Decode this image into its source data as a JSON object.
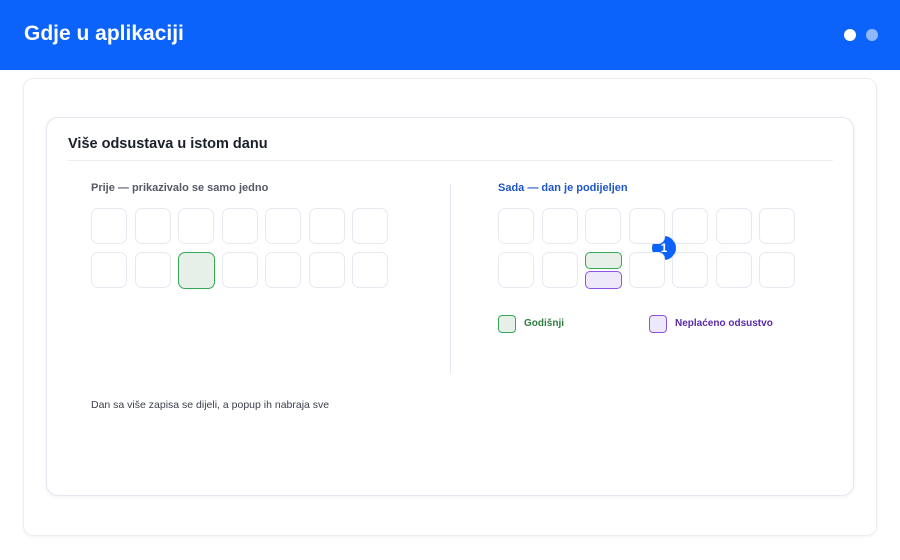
{
  "header": {
    "title": "Gdje u aplikaciji",
    "step_dots": 2,
    "active_step": 1
  },
  "card": {
    "title": "Više odsustava u istom danu",
    "before": {
      "label": "Prije — prikazivalo se samo jedno"
    },
    "after": {
      "label": "Sada — dan je podijeljen",
      "badge": "1"
    },
    "legend": [
      {
        "label": "Godišnji",
        "color": "#34a853"
      },
      {
        "label": "Neplaćeno odsustvo",
        "color": "#8a55e6"
      }
    ],
    "footnote": "Dan sa više zapisa se dijeli, a popup ih nabraja sve"
  },
  "colors": {
    "brand": "#0b63fb",
    "annual_leave": "#34a853",
    "unpaid_leave": "#8a55e6"
  }
}
